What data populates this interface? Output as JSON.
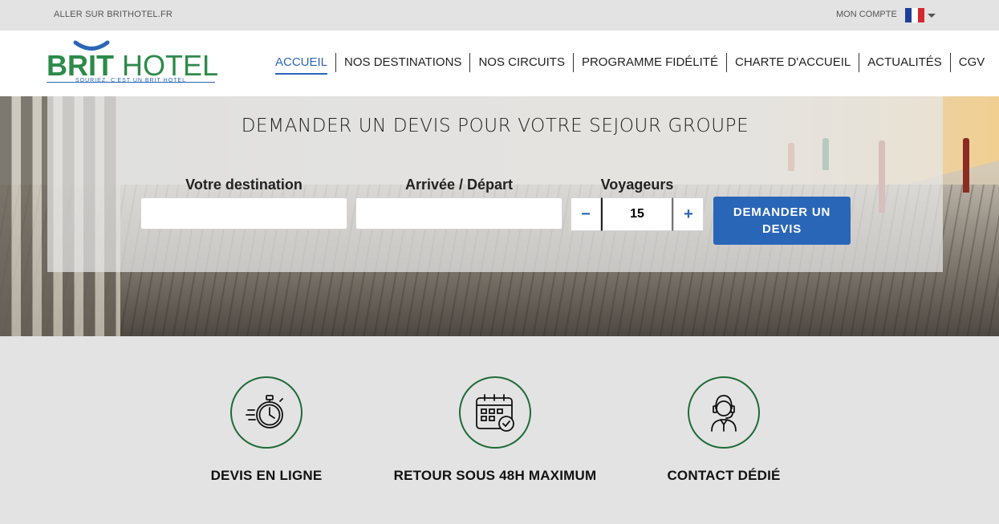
{
  "topbar": {
    "site_link": "ALLER SUR BRITHOTEL.FR",
    "account_link": "MON COMPTE",
    "flag_colors": [
      "#1f3f96",
      "#ffffff",
      "#d6282f"
    ]
  },
  "logo": {
    "brand_bold": "BRIT",
    "brand_light": "HOTEL",
    "tagline": "SOURIEZ, C'EST UN BRIT HOTEL",
    "green": "#2d8a4a",
    "blue": "#2a66b8"
  },
  "nav": {
    "items": [
      {
        "label": "ACCUEIL",
        "active": true
      },
      {
        "label": "NOS DESTINATIONS"
      },
      {
        "label": "NOS CIRCUITS"
      },
      {
        "label": "PROGRAMME FIDÉLITÉ"
      },
      {
        "label": "CHARTE D'ACCUEIL"
      },
      {
        "label": "ACTUALITÉS"
      },
      {
        "label": "CGV"
      }
    ]
  },
  "search": {
    "title": "DEMANDER UN DEVIS POUR VOTRE SEJOUR GROUPE",
    "destination_label": "Votre destination",
    "destination_value": "",
    "dates_label": "Arrivée / Départ",
    "dates_value": "",
    "travelers_label": "Voyageurs",
    "travelers_value": "15",
    "minus": "−",
    "plus": "+",
    "submit_line1": "DEMANDER UN",
    "submit_line2": "DEVIS"
  },
  "features": [
    {
      "icon": "stopwatch-icon",
      "label": "DEVIS EN LIGNE"
    },
    {
      "icon": "calendar-check-icon",
      "label": "RETOUR SOUS 48H MAXIMUM"
    },
    {
      "icon": "support-agent-icon",
      "label": "CONTACT DÉDIÉ"
    }
  ],
  "colors": {
    "accent_blue": "#2a66b8",
    "feature_green": "#1f6b37",
    "background": "#e3e3e3"
  }
}
